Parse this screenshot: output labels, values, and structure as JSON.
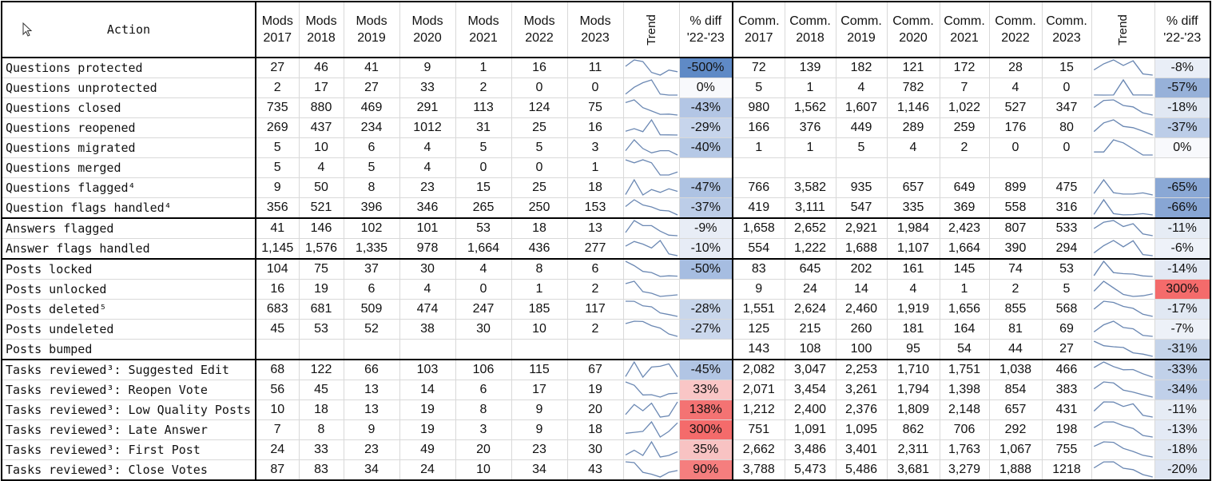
{
  "header": {
    "action": "Action",
    "mods_years": [
      "Mods\n2017",
      "Mods\n2018",
      "Mods\n2019",
      "Mods\n2020",
      "Mods\n2021",
      "Mods\n2022",
      "Mods\n2023"
    ],
    "comm_years": [
      "Comm.\n2017",
      "Comm.\n2018",
      "Comm.\n2019",
      "Comm.\n2020",
      "Comm.\n2021",
      "Comm.\n2022",
      "Comm.\n2023"
    ],
    "trend": "Trend",
    "pct_diff": "% diff\n'22-'23"
  },
  "colors": {
    "sparkline": "#6b88b3",
    "neg_strong": "#5b86c4",
    "pos_strong": "#f46b6b"
  },
  "rows": [
    {
      "action": "Questions protected",
      "mods": [
        "27",
        "46",
        "41",
        "9",
        "1",
        "16",
        "11"
      ],
      "mods_diff": "-500%",
      "mods_bg": "#5f8ac6",
      "comm": [
        "72",
        "139",
        "182",
        "121",
        "172",
        "28",
        "15"
      ],
      "comm_diff": "-8%",
      "comm_bg": "#e9eef7"
    },
    {
      "action": "Questions unprotected",
      "mods": [
        "2",
        "17",
        "27",
        "33",
        "2",
        "0",
        "0"
      ],
      "mods_diff": "0%",
      "mods_bg": "#f8f9fc",
      "comm": [
        "5",
        "1",
        "4",
        "782",
        "7",
        "4",
        "0"
      ],
      "comm_diff": "-57%",
      "comm_bg": "#97b1d9"
    },
    {
      "action": "Questions closed",
      "mods": [
        "735",
        "880",
        "469",
        "291",
        "113",
        "124",
        "75"
      ],
      "mods_diff": "-43%",
      "mods_bg": "#b3c6e5",
      "comm": [
        "980",
        "1,562",
        "1,607",
        "1,146",
        "1,022",
        "527",
        "347"
      ],
      "comm_diff": "-18%",
      "comm_bg": "#e1e8f3"
    },
    {
      "action": "Questions reopened",
      "mods": [
        "269",
        "437",
        "234",
        "1012",
        "31",
        "25",
        "16"
      ],
      "mods_diff": "-29%",
      "mods_bg": "#c7d5ec",
      "comm": [
        "166",
        "376",
        "449",
        "289",
        "259",
        "176",
        "80"
      ],
      "comm_diff": "-37%",
      "comm_bg": "#bccde8"
    },
    {
      "action": "Questions migrated",
      "mods": [
        "5",
        "10",
        "6",
        "4",
        "5",
        "5",
        "3"
      ],
      "mods_diff": "-40%",
      "mods_bg": "#b6c9e6",
      "comm": [
        "1",
        "1",
        "5",
        "4",
        "2",
        "0",
        "0"
      ],
      "comm_diff": "0%",
      "comm_bg": "#f8f9fc"
    },
    {
      "action": "Questions merged",
      "mods": [
        "5",
        "4",
        "5",
        "4",
        "0",
        "0",
        "1"
      ],
      "mods_diff": "",
      "mods_bg": "#ffffff",
      "comm": [
        "",
        "",
        "",
        "",
        "",
        "",
        ""
      ],
      "comm_diff": "",
      "comm_bg": "#ffffff"
    },
    {
      "action": "Questions flagged⁴",
      "mods": [
        "9",
        "50",
        "8",
        "23",
        "15",
        "25",
        "18"
      ],
      "mods_diff": "-47%",
      "mods_bg": "#aec3e3",
      "comm": [
        "766",
        "3,582",
        "935",
        "657",
        "649",
        "899",
        "475"
      ],
      "comm_diff": "-65%",
      "comm_bg": "#8aa8d5"
    },
    {
      "action": "Question flags handled⁴",
      "mods": [
        "356",
        "521",
        "396",
        "346",
        "265",
        "250",
        "153"
      ],
      "mods_diff": "-37%",
      "mods_bg": "#bccde8",
      "comm": [
        "419",
        "3,111",
        "547",
        "335",
        "369",
        "558",
        "316"
      ],
      "comm_diff": "-66%",
      "comm_bg": "#88a6d4"
    },
    {
      "action": "Answers flagged",
      "mods": [
        "41",
        "146",
        "102",
        "101",
        "53",
        "18",
        "13"
      ],
      "mods_diff": "-9%",
      "mods_bg": "#e8edf6",
      "comm": [
        "1,658",
        "2,652",
        "2,921",
        "1,984",
        "2,423",
        "807",
        "533"
      ],
      "comm_diff": "-11%",
      "comm_bg": "#e6ecf5"
    },
    {
      "action": "Answer flags handled",
      "mods": [
        "1,145",
        "1,576",
        "1,335",
        "978",
        "1,664",
        "436",
        "277"
      ],
      "mods_diff": "-10%",
      "mods_bg": "#e7ecf6",
      "comm": [
        "554",
        "1,222",
        "1,688",
        "1,107",
        "1,664",
        "390",
        "294"
      ],
      "comm_diff": "-6%",
      "comm_bg": "#eef2f9"
    },
    {
      "action": "Posts locked",
      "mods": [
        "104",
        "75",
        "37",
        "30",
        "4",
        "8",
        "6"
      ],
      "mods_diff": "-50%",
      "mods_bg": "#a6bde1",
      "comm": [
        "83",
        "645",
        "202",
        "161",
        "145",
        "74",
        "53"
      ],
      "comm_diff": "-14%",
      "comm_bg": "#e3e9f4"
    },
    {
      "action": "Posts unlocked",
      "mods": [
        "16",
        "19",
        "6",
        "4",
        "0",
        "1",
        "2"
      ],
      "mods_diff": "",
      "mods_bg": "#ffffff",
      "comm": [
        "9",
        "24",
        "14",
        "4",
        "1",
        "2",
        "5"
      ],
      "comm_diff": "300%",
      "comm_bg": "#f46b6b"
    },
    {
      "action": "Posts deleted⁵",
      "mods": [
        "683",
        "681",
        "509",
        "474",
        "247",
        "185",
        "117"
      ],
      "mods_diff": "-28%",
      "mods_bg": "#c9d7ec",
      "comm": [
        "1,551",
        "2,624",
        "2,460",
        "1,919",
        "1,656",
        "855",
        "568"
      ],
      "comm_diff": "-17%",
      "comm_bg": "#e1e8f3"
    },
    {
      "action": "Posts undeleted",
      "mods": [
        "45",
        "53",
        "52",
        "38",
        "30",
        "10",
        "2"
      ],
      "mods_diff": "-27%",
      "mods_bg": "#cbd8ed",
      "comm": [
        "125",
        "215",
        "260",
        "181",
        "164",
        "81",
        "69"
      ],
      "comm_diff": "-7%",
      "comm_bg": "#edf1f8"
    },
    {
      "action": "Posts bumped",
      "mods": [
        "",
        "",
        "",
        "",
        "",
        "",
        ""
      ],
      "mods_diff": "",
      "mods_bg": "#ffffff",
      "comm": [
        "143",
        "108",
        "100",
        "95",
        "54",
        "44",
        "27"
      ],
      "comm_diff": "-31%",
      "comm_bg": "#c5d4ea"
    },
    {
      "action": "Tasks reviewed³: Suggested Edit",
      "mods": [
        "68",
        "122",
        "66",
        "103",
        "106",
        "115",
        "67"
      ],
      "mods_diff": "-45%",
      "mods_bg": "#b1c5e4",
      "comm": [
        "2,082",
        "3,047",
        "2,253",
        "1,710",
        "1,751",
        "1,038",
        "466"
      ],
      "comm_diff": "-33%",
      "comm_bg": "#c1d1e9"
    },
    {
      "action": "Tasks reviewed³: Reopen Vote",
      "mods": [
        "56",
        "45",
        "13",
        "14",
        "6",
        "17",
        "19"
      ],
      "mods_diff": "33%",
      "mods_bg": "#f9c6c6",
      "comm": [
        "2,071",
        "3,454",
        "3,261",
        "1,794",
        "1,398",
        "854",
        "383"
      ],
      "comm_diff": "-34%",
      "comm_bg": "#c0d0e9"
    },
    {
      "action": "Tasks reviewed³: Low Quality Posts",
      "mods": [
        "10",
        "18",
        "13",
        "19",
        "8",
        "9",
        "20"
      ],
      "mods_diff": "138%",
      "mods_bg": "#f47373",
      "comm": [
        "1,212",
        "2,400",
        "2,376",
        "1,809",
        "2,148",
        "657",
        "431"
      ],
      "comm_diff": "-11%",
      "comm_bg": "#e6ecf5"
    },
    {
      "action": "Tasks reviewed³: Late Answer",
      "mods": [
        "7",
        "8",
        "9",
        "19",
        "3",
        "9",
        "18"
      ],
      "mods_diff": "300%",
      "mods_bg": "#f46b6b",
      "comm": [
        "751",
        "1,091",
        "1,095",
        "862",
        "706",
        "292",
        "198"
      ],
      "comm_diff": "-13%",
      "comm_bg": "#e4eaf5"
    },
    {
      "action": "Tasks reviewed³: First Post",
      "mods": [
        "24",
        "33",
        "23",
        "49",
        "20",
        "23",
        "30"
      ],
      "mods_diff": "35%",
      "mods_bg": "#f8c3c3",
      "comm": [
        "2,662",
        "3,486",
        "3,401",
        "2,311",
        "1,763",
        "1,067",
        "755"
      ],
      "comm_diff": "-18%",
      "comm_bg": "#e1e8f3"
    },
    {
      "action": "Tasks reviewed³: Close Votes",
      "mods": [
        "87",
        "83",
        "34",
        "24",
        "10",
        "34",
        "43"
      ],
      "mods_diff": "90%",
      "mods_bg": "#f57e7e",
      "comm": [
        "3,788",
        "5,473",
        "5,486",
        "3,681",
        "3,279",
        "1,888",
        "1218"
      ],
      "comm_diff": "-20%",
      "comm_bg": "#dfe6f3"
    }
  ],
  "group_starts": [
    8,
    10,
    15
  ]
}
